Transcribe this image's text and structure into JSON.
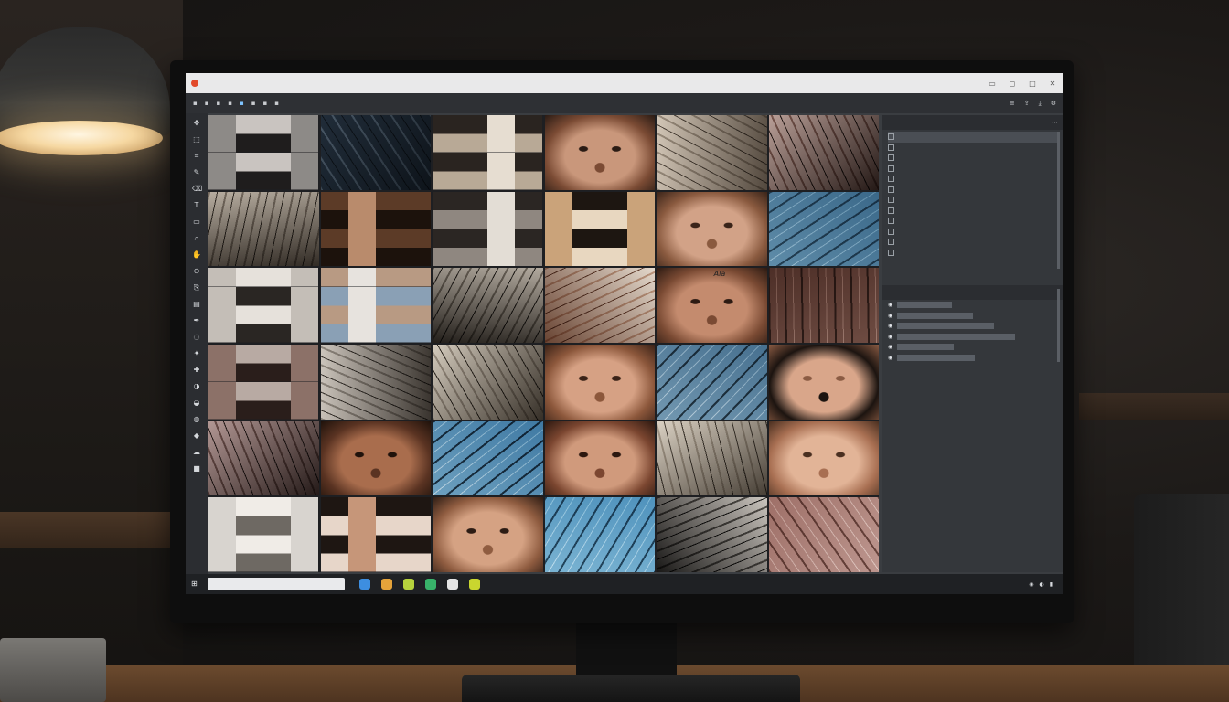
{
  "titlebar": {
    "title": "",
    "controls": [
      "minimize-icon",
      "restore-icon",
      "close-icon"
    ]
  },
  "toolbar": {
    "items": [
      "",
      "",
      "",
      "",
      "",
      "",
      "",
      ""
    ],
    "right_icons": [
      "layers-icon",
      "share-icon",
      "export-icon",
      "settings-icon"
    ]
  },
  "tools": [
    "move-icon",
    "select-icon",
    "crop-icon",
    "brush-icon",
    "eraser-icon",
    "text-icon",
    "shape-icon",
    "zoom-icon",
    "hand-icon",
    "eyedropper-icon",
    "clone-icon",
    "gradient-icon",
    "pen-icon",
    "lasso-icon",
    "wand-icon",
    "heal-icon",
    "dodge-icon",
    "burn-icon",
    "blur-icon",
    "sharpen-icon",
    "smudge-icon",
    "color-icon"
  ],
  "grid": {
    "tiles": [
      {
        "kind": "mosaic",
        "c1": "#8d8a87",
        "c2": "#1f1d1d",
        "c3": "#c9c4c0"
      },
      {
        "kind": "fabric",
        "c1": "#5b6a78",
        "c2": "#cdd3d9",
        "c3": "#273038"
      },
      {
        "kind": "mosaic",
        "c1": "#e6ddd1",
        "c2": "#b8a996",
        "c3": "#2a2420"
      },
      {
        "kind": "face",
        "c1": "#c9977b",
        "c2": "#7b4b34",
        "c3": "#2a1b14"
      },
      {
        "kind": "fabric",
        "c1": "#e8e1d8",
        "c2": "#a99f93",
        "c3": "#5b5249"
      },
      {
        "kind": "fabric",
        "c1": "#d9c9c4",
        "c2": "#8b6b62",
        "c3": "#2a1f1c"
      },
      {
        "kind": "fabric",
        "c1": "#d8d2ca",
        "c2": "#8a8178",
        "c3": "#3b352f"
      },
      {
        "kind": "mosaic",
        "c1": "#b98b6c",
        "c2": "#5c3b27",
        "c3": "#1c120c"
      },
      {
        "kind": "mosaic",
        "c1": "#e3ddd5",
        "c2": "#8f8780",
        "c3": "#2b2623"
      },
      {
        "kind": "mosaic",
        "c1": "#caa37a",
        "c2": "#1d1611",
        "c3": "#e8d7c0"
      },
      {
        "kind": "face",
        "c1": "#d2a287",
        "c2": "#8a5a3f",
        "c3": "#3a2419"
      },
      {
        "kind": "fabric",
        "c1": "#7aa3bb",
        "c2": "#2f4a5c",
        "c3": "#c6dbe6"
      },
      {
        "kind": "mosaic",
        "c1": "#c4beb7",
        "c2": "#2a2623",
        "c3": "#e6e1db"
      },
      {
        "kind": "mosaic",
        "c1": "#e7e3de",
        "c2": "#b89a83",
        "c3": "#8aa0b5"
      },
      {
        "kind": "fabric",
        "c1": "#d5d0c9",
        "c2": "#7f786f",
        "c3": "#2a2622"
      },
      {
        "kind": "fabric",
        "c1": "#f1ebe4",
        "c2": "#c8a58f",
        "c3": "#6f4a39"
      },
      {
        "kind": "face",
        "c1": "#c48b6e",
        "c2": "#7a4a33",
        "c3": "#2c1a12",
        "label": "Ala"
      },
      {
        "kind": "fabric",
        "c1": "#8c6d64",
        "c2": "#3b2a25",
        "c3": "#c9b2aa"
      },
      {
        "kind": "mosaic",
        "c1": "#8c7168",
        "c2": "#2a1e1b",
        "c3": "#b8aaa3"
      },
      {
        "kind": "fabric",
        "c1": "#e4e0db",
        "c2": "#9e9891",
        "c3": "#403b36"
      },
      {
        "kind": "fabric",
        "c1": "#e9e4dc",
        "c2": "#aaa197",
        "c3": "#3b352e"
      },
      {
        "kind": "face",
        "c1": "#d6a184",
        "c2": "#8c573b",
        "c3": "#3a2217"
      },
      {
        "kind": "fabric",
        "c1": "#86a9bf",
        "c2": "#283a46",
        "c3": "#d9e5ec"
      },
      {
        "kind": "face",
        "c1": "#d9a68a",
        "c2": "#1c1410",
        "c3": "#8a5b43"
      },
      {
        "kind": "fabric",
        "c1": "#d5c4c2",
        "c2": "#7f6560",
        "c3": "#2c2220"
      },
      {
        "kind": "face",
        "c1": "#a96d4d",
        "c2": "#5a3322",
        "c3": "#1f120b"
      },
      {
        "kind": "fabric",
        "c1": "#7fb0cc",
        "c2": "#1f3342",
        "c3": "#dbe8ef"
      },
      {
        "kind": "face",
        "c1": "#d09a7c",
        "c2": "#7b4630",
        "c3": "#2c1810"
      },
      {
        "kind": "fabric",
        "c1": "#ece7df",
        "c2": "#b7aea2",
        "c3": "#4c453d"
      },
      {
        "kind": "face",
        "c1": "#e2b497",
        "c2": "#a86f52",
        "c3": "#4a2f20"
      },
      {
        "kind": "mosaic",
        "c1": "#d8d4cf",
        "c2": "#6e6963",
        "c3": "#f0ece7"
      },
      {
        "kind": "mosaic",
        "c1": "#c69679",
        "c2": "#1e1612",
        "c3": "#e7d6c9"
      },
      {
        "kind": "face",
        "c1": "#d5a283",
        "c2": "#8f5c40",
        "c3": "#2d1c14"
      },
      {
        "kind": "fabric",
        "c1": "#8ec1db",
        "c2": "#2a4b60",
        "c3": "#dcedf5"
      },
      {
        "kind": "fabric",
        "c1": "#e3e0dc",
        "c2": "#5c5955",
        "c3": "#1c1b1a"
      },
      {
        "kind": "fabric",
        "c1": "#c9a9a3",
        "c2": "#6e4c45",
        "c3": "#efe2de"
      }
    ]
  },
  "panel": {
    "header": "",
    "layers": [
      "",
      "",
      "",
      "",
      "",
      "",
      "",
      "",
      "",
      "",
      "",
      ""
    ],
    "selected_index": 0,
    "sub_header": "",
    "sub_rows": [
      "",
      "",
      "",
      "",
      "",
      ""
    ]
  },
  "taskbar": {
    "search_placeholder": "",
    "apps": [
      {
        "name": "explorer-app-icon",
        "color": "#3d8ee0"
      },
      {
        "name": "folder-app-icon",
        "color": "#e5a33a"
      },
      {
        "name": "sheets-app-icon",
        "color": "#b6d33d"
      },
      {
        "name": "chat-app-icon",
        "color": "#38b36a"
      },
      {
        "name": "media-app-icon",
        "color": "#e5e5e5"
      },
      {
        "name": "browser-app-icon",
        "color": "#c9d62f"
      }
    ],
    "clock": ""
  }
}
